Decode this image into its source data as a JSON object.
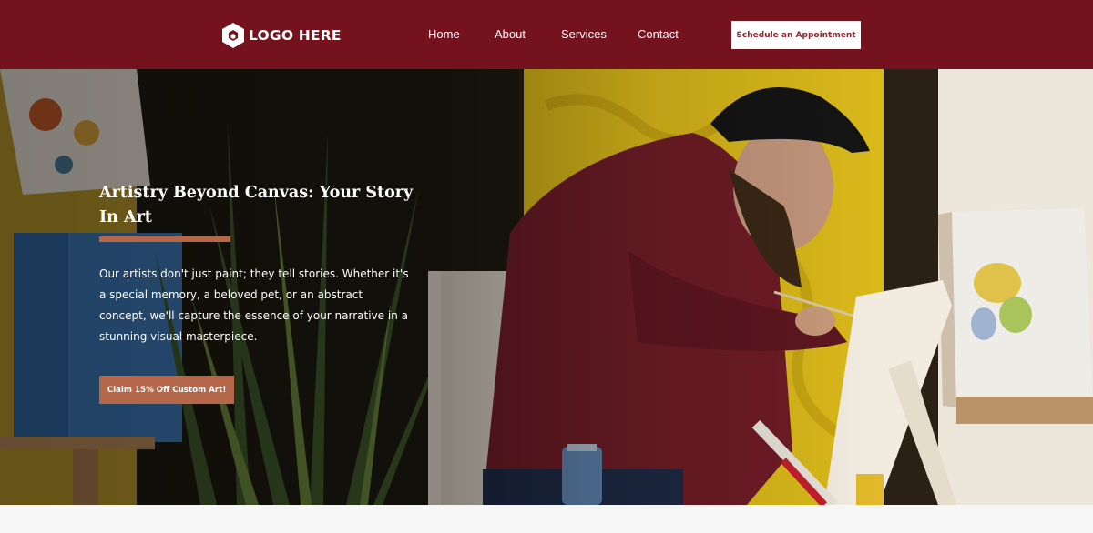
{
  "header": {
    "logo_text": "LOGO HERE",
    "logo_icon": "hexagon-logo-icon",
    "nav": [
      "Home",
      "About",
      "Services",
      "Contact"
    ],
    "cta_label": "Schedule an Appointment",
    "background_color": "#74121d"
  },
  "hero": {
    "title": "Artistry Beyond Canvas: Your Story In Art",
    "description": "Our artists don't just paint; they tell stories. Whether it's a special memory, a beloved pet, or an abstract concept, we'll capture the essence of your narrative in a stunning visual masterpiece.",
    "cta_label": "Claim 15% Off Custom Art!",
    "accent_color": "#b5674a"
  }
}
